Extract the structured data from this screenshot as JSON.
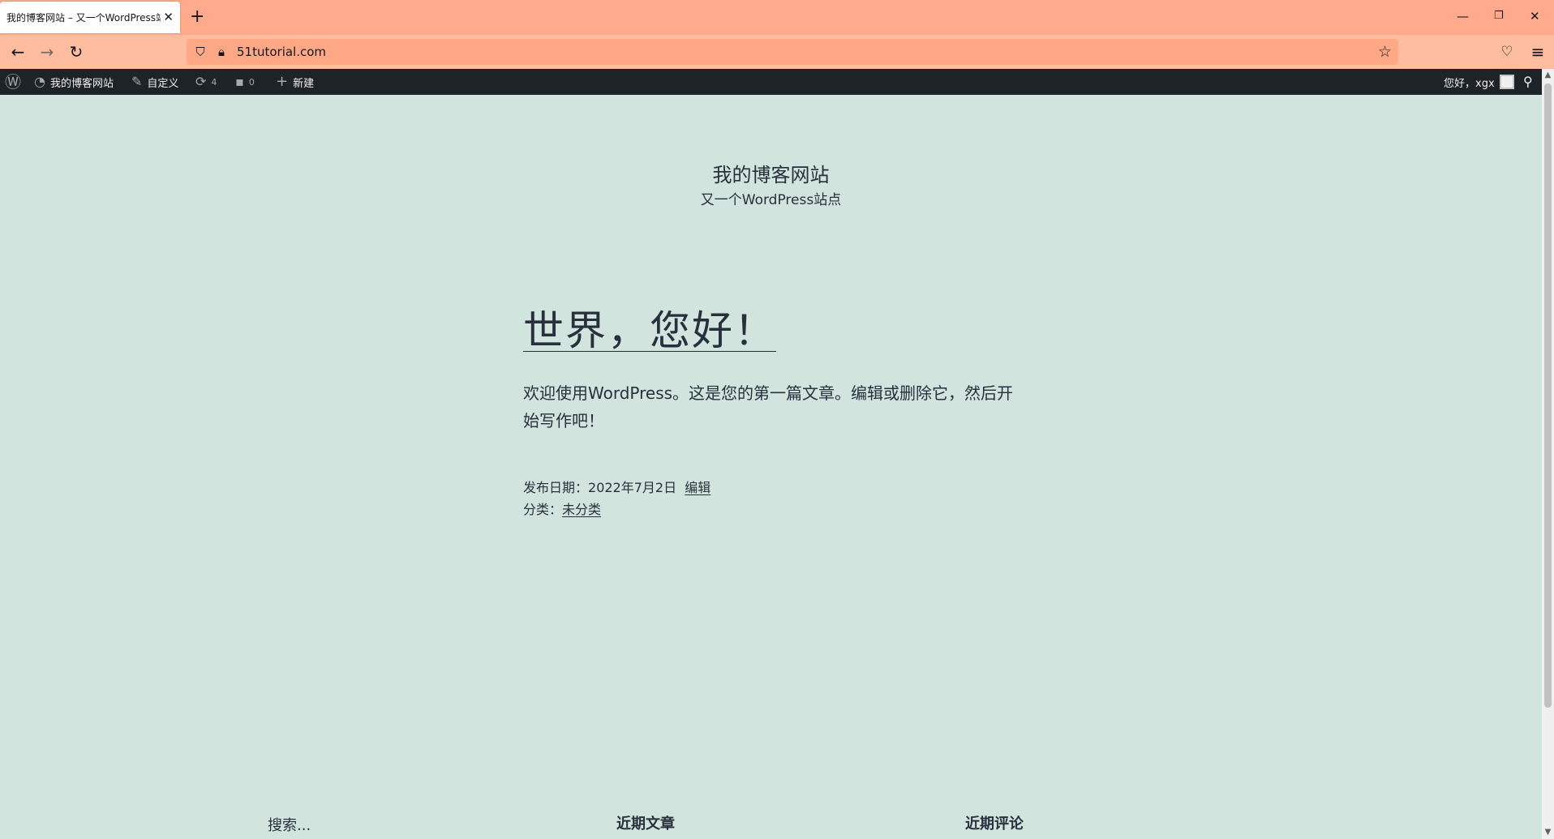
{
  "browser": {
    "tab_title": "我的博客网站 – 又一个WordPress站点",
    "url": "51tutorial.com"
  },
  "admin_bar": {
    "site_name": "我的博客网站",
    "customize": "自定义",
    "updates_count": "4",
    "comments_count": "0",
    "new": "新建",
    "greeting": "您好，xgx"
  },
  "site": {
    "title": "我的博客网站",
    "description": "又一个WordPress站点"
  },
  "post": {
    "title": "世界，您好！",
    "body": "欢迎使用WordPress。这是您的第一篇文章。编辑或删除它，然后开始写作吧！",
    "date_label": "发布日期：",
    "date": "2022年7月2日",
    "edit": "编辑",
    "category_label": "分类：",
    "category": "未分类"
  },
  "footer": {
    "search_placeholder": "搜索...",
    "recent_posts": "近期文章",
    "recent_comments": "近期评论"
  }
}
